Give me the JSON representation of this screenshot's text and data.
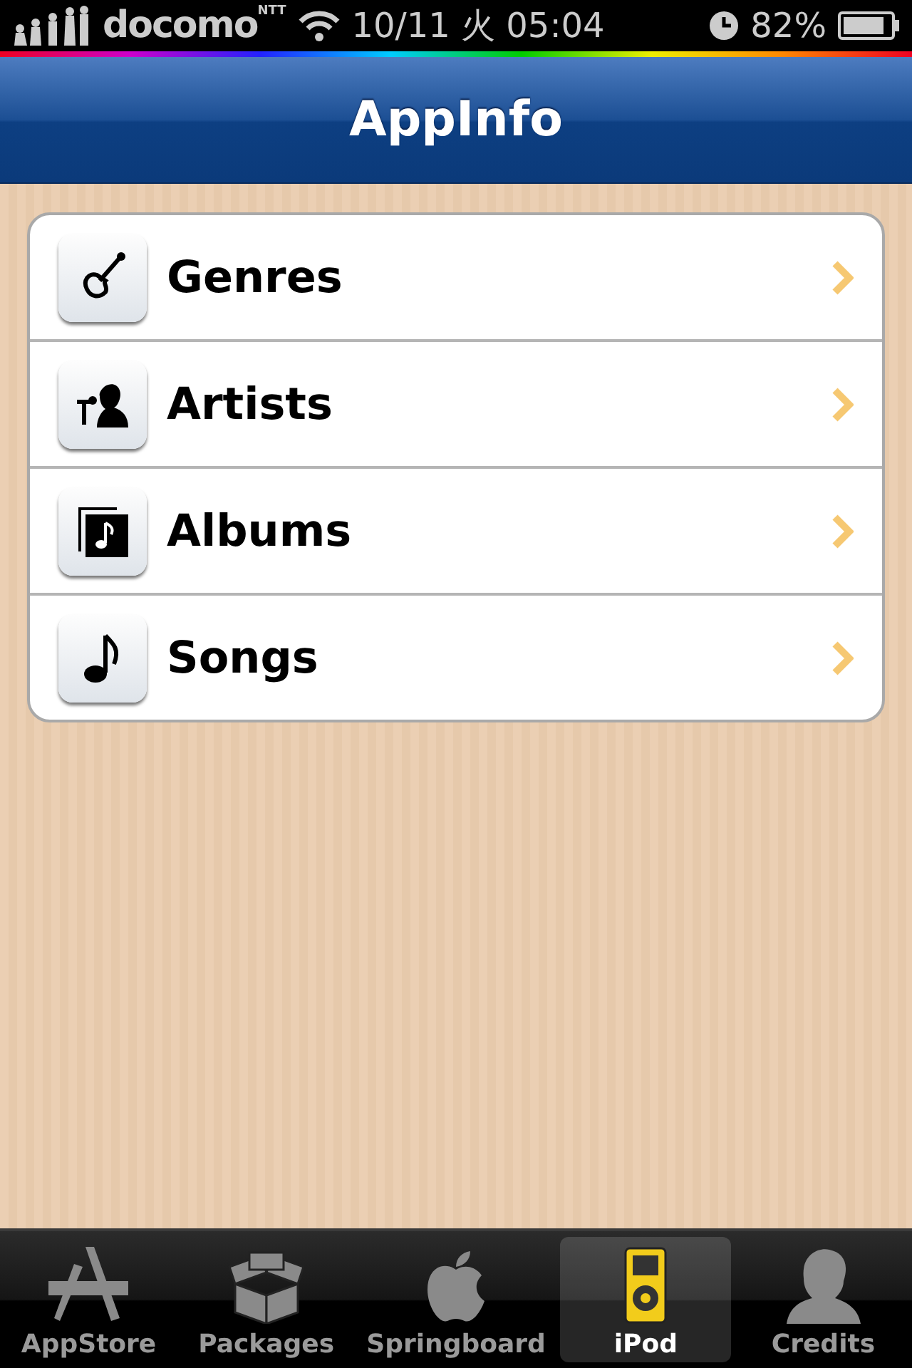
{
  "status_bar": {
    "carrier_mark": "NTT",
    "carrier": "docomo",
    "time": "10/11 火 05:04",
    "battery": "82%"
  },
  "nav_bar": {
    "title": "AppInfo"
  },
  "list": [
    {
      "kind": "genres",
      "label": "Genres"
    },
    {
      "kind": "artists",
      "label": "Artists"
    },
    {
      "kind": "albums",
      "label": "Albums"
    },
    {
      "kind": "songs",
      "label": "Songs"
    }
  ],
  "tab_bar": [
    {
      "kind": "appstore",
      "label": "AppStore",
      "selected": false
    },
    {
      "kind": "packages",
      "label": "Packages",
      "selected": false
    },
    {
      "kind": "springboard",
      "label": "Springboard",
      "selected": false
    },
    {
      "kind": "ipod",
      "label": "iPod",
      "selected": true
    },
    {
      "kind": "credits",
      "label": "Credits",
      "selected": false
    }
  ]
}
